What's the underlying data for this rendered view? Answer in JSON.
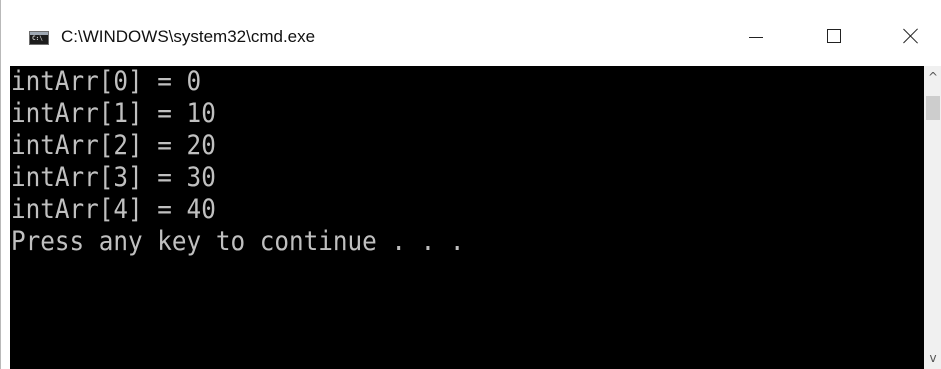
{
  "window": {
    "title": "C:\\WINDOWS\\system32\\cmd.exe",
    "icon": "cmd-console-icon",
    "icon_text": "C:\\",
    "controls": {
      "minimize": "minimize-icon",
      "maximize": "maximize-icon",
      "close": "close-icon"
    }
  },
  "console": {
    "background": "#000000",
    "foreground": "#c0c0c0",
    "lines": [
      "intArr[0] = 0",
      "intArr[1] = 10",
      "intArr[2] = 20",
      "intArr[3] = 30",
      "intArr[4] = 40",
      "Press any key to continue . . ."
    ]
  },
  "scrollbar": {
    "up_arrow": "^",
    "down_arrow": "v"
  }
}
